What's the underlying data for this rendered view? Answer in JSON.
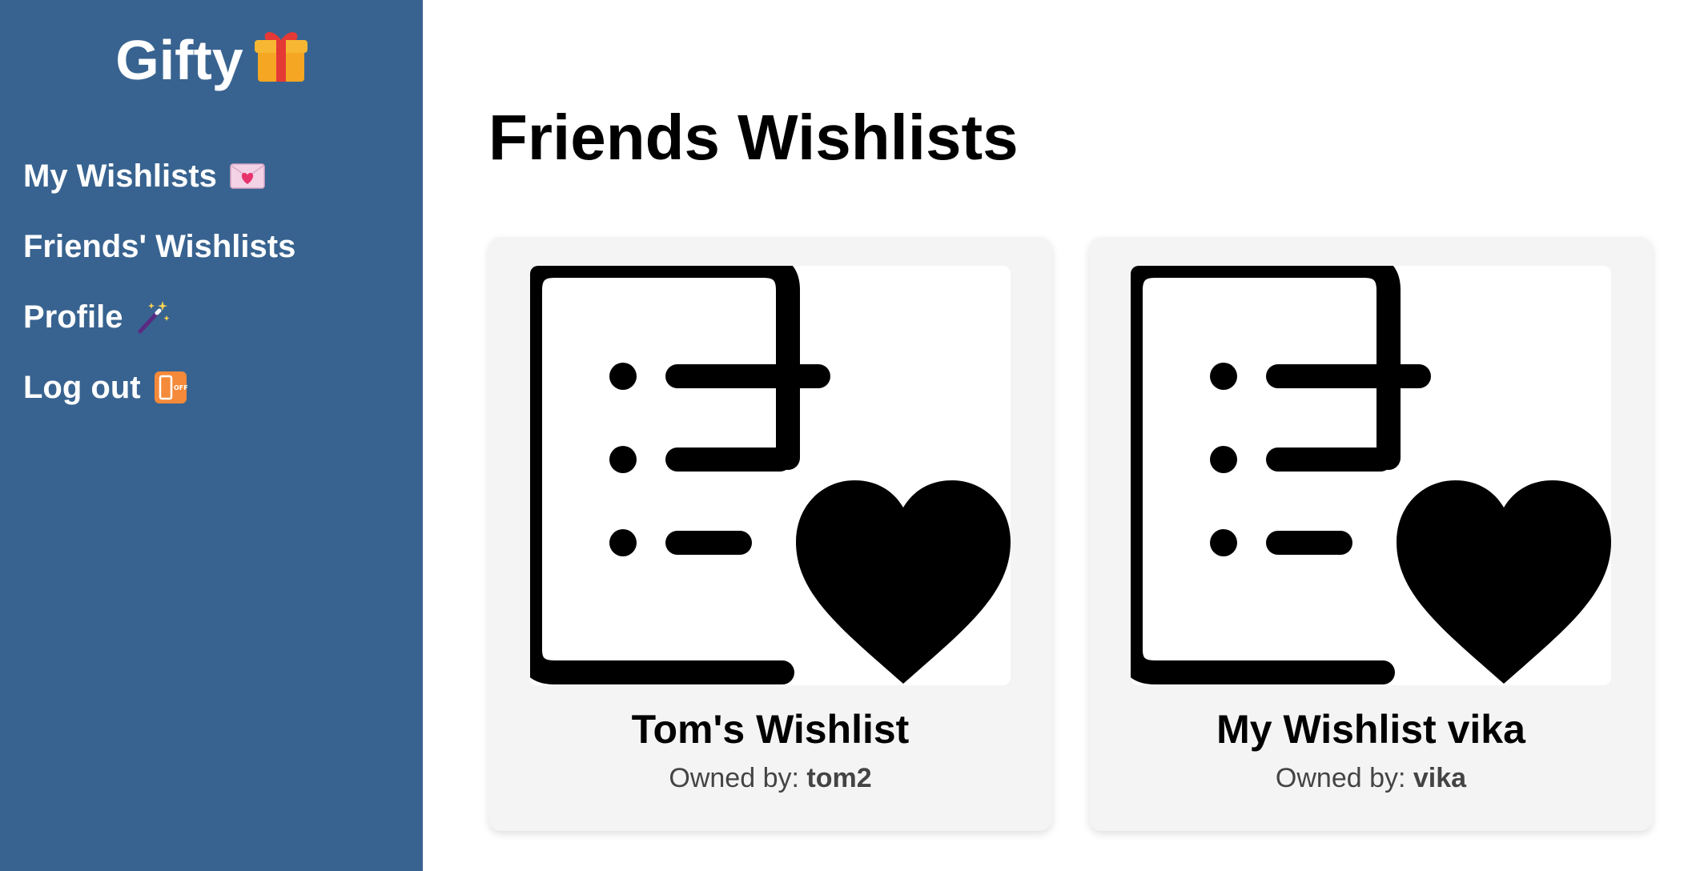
{
  "app": {
    "title": "Gifty",
    "logo_icon": "gift-icon"
  },
  "sidebar": {
    "items": [
      {
        "label": "My Wishlists",
        "icon": "love-letter-icon"
      },
      {
        "label": "Friends' Wishlists",
        "icon": ""
      },
      {
        "label": "Profile",
        "icon": "magic-wand-icon"
      },
      {
        "label": "Log out",
        "icon": "mobile-phone-off-icon"
      }
    ]
  },
  "main": {
    "title": "Friends Wishlists",
    "wishlists": [
      {
        "title": "Tom's Wishlist",
        "owner_prefix": "Owned by:",
        "owner": "tom2",
        "image_icon": "wishlist-heart-icon"
      },
      {
        "title": "My Wishlist vika",
        "owner_prefix": "Owned by:",
        "owner": "vika",
        "image_icon": "wishlist-heart-icon"
      }
    ]
  },
  "colors": {
    "sidebar_bg": "#386390",
    "card_bg": "#f4f4f4",
    "text": "#000000",
    "muted_text": "#444444"
  }
}
